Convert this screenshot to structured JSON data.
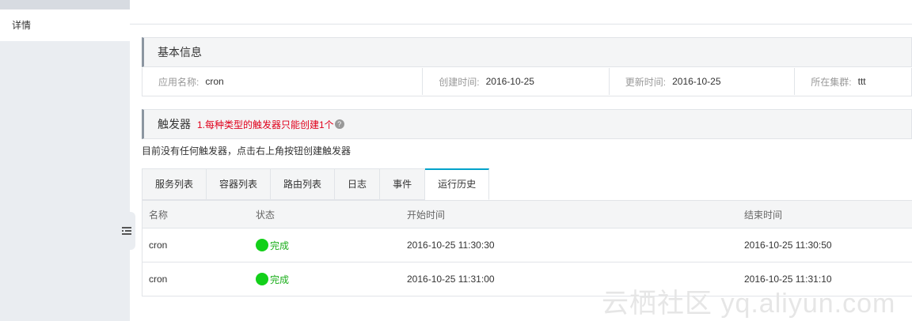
{
  "sidebar": {
    "items": [
      {
        "label": "详情"
      }
    ]
  },
  "basic_info": {
    "title": "基本信息",
    "fields": [
      {
        "label": "应用名称:",
        "value": "cron"
      },
      {
        "label": "创建时间:",
        "value": "2016-10-25"
      },
      {
        "label": "更新时间:",
        "value": "2016-10-25"
      },
      {
        "label": "所在集群:",
        "value": "ttt"
      }
    ]
  },
  "triggers": {
    "title": "触发器",
    "note": "1.每种类型的触发器只能创建1个",
    "help_icon": "question-circle-icon",
    "empty_text": "目前没有任何触发器，点击右上角按钮创建触发器"
  },
  "tabs": [
    {
      "label": "服务列表"
    },
    {
      "label": "容器列表"
    },
    {
      "label": "路由列表"
    },
    {
      "label": "日志"
    },
    {
      "label": "事件"
    },
    {
      "label": "运行历史",
      "active": true
    }
  ],
  "history_table": {
    "columns": [
      "名称",
      "状态",
      "开始时间",
      "结束时间"
    ],
    "rows": [
      {
        "name": "cron",
        "status": "完成",
        "start": "2016-10-25 11:30:30",
        "end": "2016-10-25 11:30:50"
      },
      {
        "name": "cron",
        "status": "完成",
        "start": "2016-10-25 11:31:00",
        "end": "2016-10-25 11:31:10"
      }
    ]
  },
  "colors": {
    "accent_tab": "#00a2ca",
    "status_ok": "#13d01a",
    "note_red": "#e0001b"
  },
  "watermark": "云栖社区 yq.aliyun.com"
}
